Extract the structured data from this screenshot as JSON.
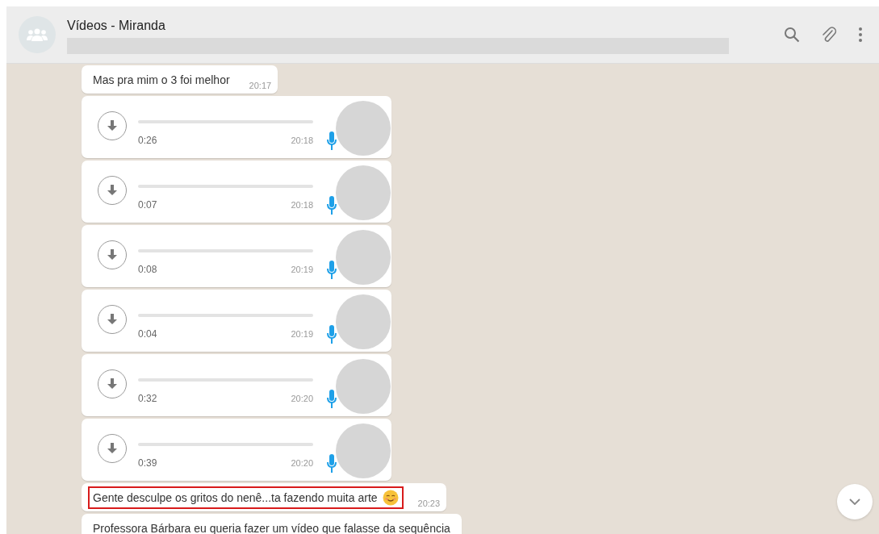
{
  "chat": {
    "title": "Vídeos - Miranda"
  },
  "messages": [
    {
      "kind": "text",
      "text": "Mas pra mim o 3 foi melhor",
      "time": "20:17",
      "highlighted": false,
      "emoji": false
    },
    {
      "kind": "audio",
      "duration": "0:26",
      "time": "20:18"
    },
    {
      "kind": "audio",
      "duration": "0:07",
      "time": "20:18"
    },
    {
      "kind": "audio",
      "duration": "0:08",
      "time": "20:19"
    },
    {
      "kind": "audio",
      "duration": "0:04",
      "time": "20:19"
    },
    {
      "kind": "audio",
      "duration": "0:32",
      "time": "20:20"
    },
    {
      "kind": "audio",
      "duration": "0:39",
      "time": "20:20"
    },
    {
      "kind": "text",
      "text": "Gente desculpe os gritos do nenê...ta fazendo muita arte",
      "time": "20:23",
      "highlighted": true,
      "emoji": true
    },
    {
      "kind": "text",
      "text": "Professora Bárbara eu queria fazer um vídeo que falasse da sequência",
      "highlighted": false,
      "emoji": false
    }
  ]
}
